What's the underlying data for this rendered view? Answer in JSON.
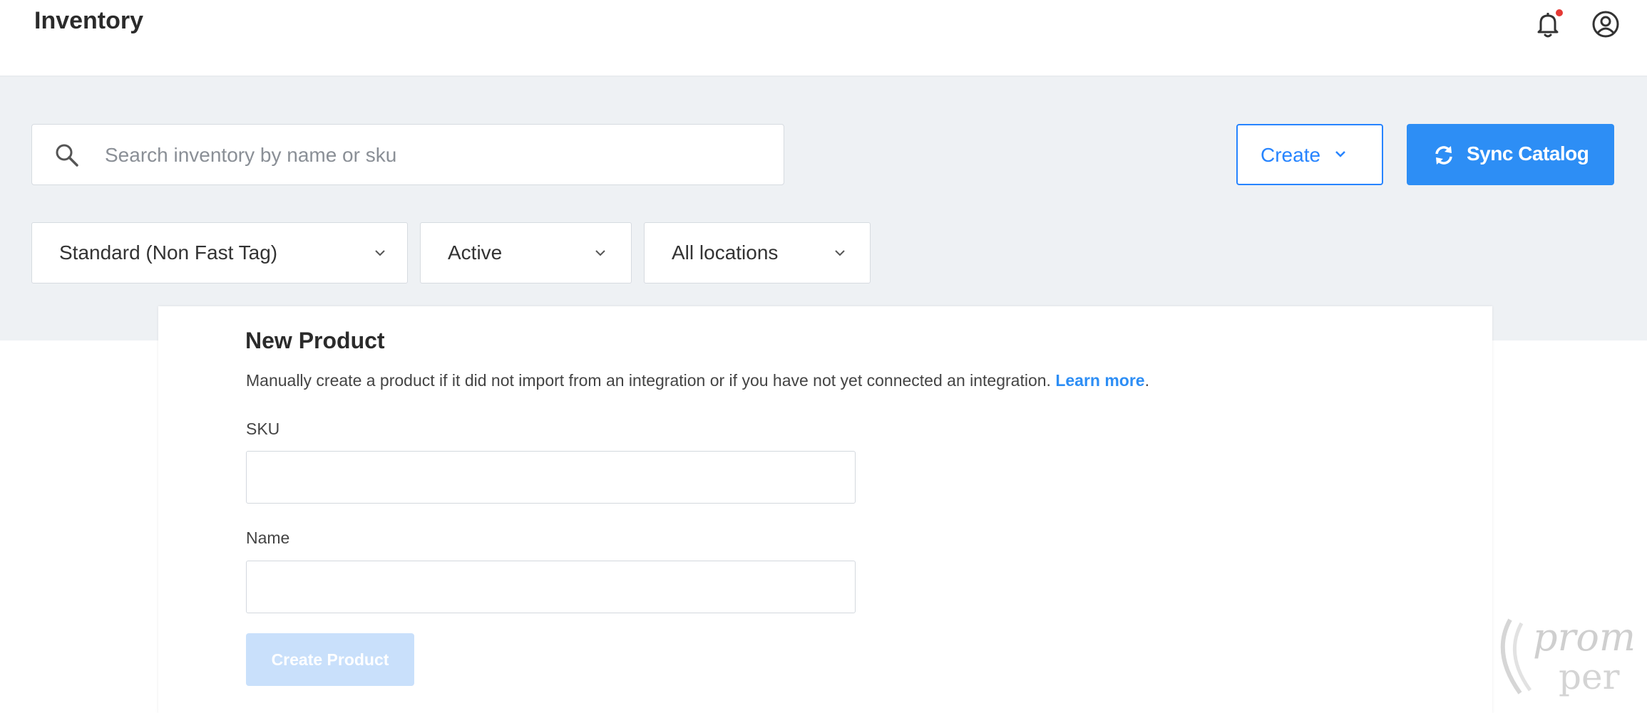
{
  "header": {
    "title": "Inventory",
    "icons": {
      "notifications": "bell-icon",
      "account": "user-circle-icon"
    },
    "notification_dot_color": "#e53935"
  },
  "toolbar": {
    "search": {
      "placeholder": "Search inventory by name or sku",
      "value": ""
    },
    "create_label": "Create",
    "sync_label": "Sync Catalog"
  },
  "filters": {
    "product_type": "Standard (Non Fast Tag)",
    "status": "Active",
    "location": "All locations"
  },
  "new_product": {
    "title": "New Product",
    "description": "Manually create a product if it did not import from an integration or if you have not yet connected an integration.",
    "learn_more": "Learn more",
    "sku_label": "SKU",
    "sku_value": "",
    "name_label": "Name",
    "name_value": "",
    "submit_label": "Create Product"
  },
  "watermark": {
    "text": "prom per"
  },
  "colors": {
    "accent": "#2d8ef5",
    "background": "#eef1f4",
    "disabled_button": "#c9e0fb"
  }
}
